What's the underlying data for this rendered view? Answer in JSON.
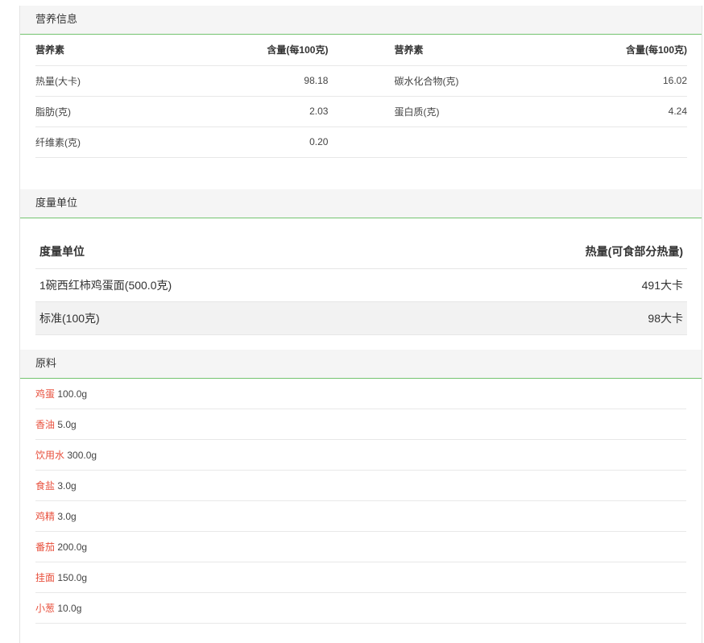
{
  "nutrition": {
    "section_title": "营养信息",
    "headers": {
      "nutrient": "营养素",
      "amount": "含量(每100克)"
    },
    "rows": [
      {
        "left_name": "热量(大卡)",
        "left_value": "98.18",
        "right_name": "碳水化合物(克)",
        "right_value": "16.02"
      },
      {
        "left_name": "脂肪(克)",
        "left_value": "2.03",
        "right_name": "蛋白质(克)",
        "right_value": "4.24"
      },
      {
        "left_name": "纤维素(克)",
        "left_value": "0.20",
        "right_name": "",
        "right_value": ""
      }
    ]
  },
  "units": {
    "section_title": "度量单位",
    "headers": {
      "unit": "度量单位",
      "calories": "热量(可食部分热量)"
    },
    "rows": [
      {
        "unit": "1碗西红柿鸡蛋面(500.0克)",
        "calories": "491大卡"
      },
      {
        "unit": "标准(100克)",
        "calories": "98大卡"
      }
    ]
  },
  "ingredients": {
    "section_title": "原料",
    "items": [
      {
        "name": "鸡蛋",
        "amount": "100.0g"
      },
      {
        "name": "香油",
        "amount": "5.0g"
      },
      {
        "name": "饮用水",
        "amount": "300.0g"
      },
      {
        "name": "食盐",
        "amount": "3.0g"
      },
      {
        "name": "鸡精",
        "amount": "3.0g"
      },
      {
        "name": "番茄",
        "amount": "200.0g"
      },
      {
        "name": "挂面",
        "amount": "150.0g"
      },
      {
        "name": "小葱",
        "amount": "10.0g"
      }
    ]
  },
  "colors": {
    "accent_line": "#74c470",
    "ingredient_link": "#e8503d",
    "header_bg": "#f5f5f5"
  }
}
